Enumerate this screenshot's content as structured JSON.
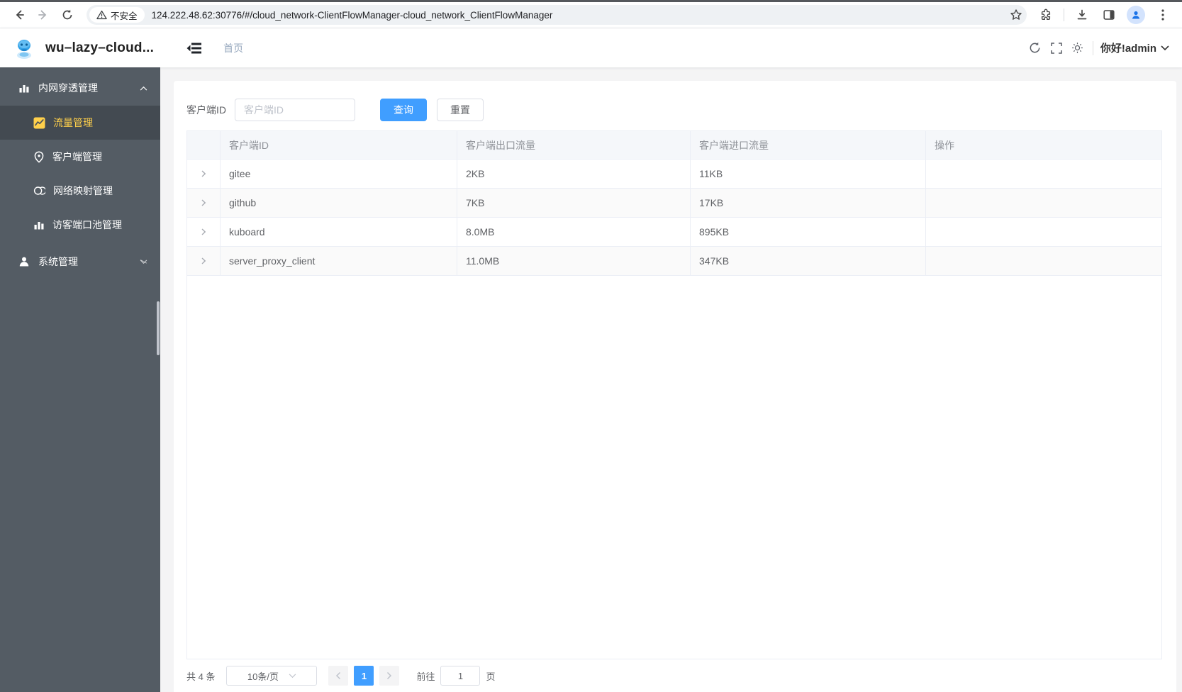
{
  "browser": {
    "security_label": "不安全",
    "url": "124.222.48.62:30776/#/cloud_network-ClientFlowManager-cloud_network_ClientFlowManager"
  },
  "app_header": {
    "title": "wu–lazy–cloud...",
    "breadcrumb": "首页",
    "greeting": "你好!admin"
  },
  "sidebar": {
    "groups": [
      {
        "label": "内网穿透管理",
        "expanded": true,
        "children": [
          {
            "label": "流量管理",
            "active": true
          },
          {
            "label": "客户端管理"
          },
          {
            "label": "网络映射管理"
          },
          {
            "label": "访客端口池管理"
          }
        ]
      },
      {
        "label": "系统管理",
        "expanded": false,
        "children": []
      }
    ]
  },
  "filter": {
    "label": "客户端ID",
    "placeholder": "客户端ID",
    "search_label": "查询",
    "reset_label": "重置"
  },
  "table": {
    "columns": [
      "",
      "客户端ID",
      "客户端出口流量",
      "客户端进口流量",
      "操作"
    ],
    "rows": [
      {
        "client_id": "gitee",
        "outbound": "2KB",
        "inbound": "11KB"
      },
      {
        "client_id": "github",
        "outbound": "7KB",
        "inbound": "17KB"
      },
      {
        "client_id": "kuboard",
        "outbound": "8.0MB",
        "inbound": "895KB"
      },
      {
        "client_id": "server_proxy_client",
        "outbound": "11.0MB",
        "inbound": "347KB"
      }
    ]
  },
  "pagination": {
    "total_label": "共 4 条",
    "page_size_label": "10条/页",
    "active_page": "1",
    "goto_label": "前往",
    "goto_value": "1",
    "page_unit_label": "页"
  },
  "colors": {
    "primary_blue": "#409eff",
    "sidebar_bg": "#545c64",
    "sidebar_active_bg": "#434a51",
    "sidebar_active_text": "#ffd04b",
    "table_header_bg": "#f5f7fa",
    "table_border": "#ebeef5"
  },
  "icons": {
    "back": "back-arrow",
    "forward": "forward-arrow",
    "reload": "reload-circular-arrow",
    "warning": "warning-triangle",
    "star": "bookmark-star",
    "extensions": "puzzle-piece",
    "download": "download-arrow-tray",
    "side_panel": "split-panel",
    "profile": "person-avatar",
    "menu": "three-dot-menu",
    "collapse": "collapse-sidebar",
    "refresh": "refresh",
    "fullscreen": "fullscreen-brackets",
    "theme": "sun",
    "caret": "chevron-down",
    "group1": "bar-chart",
    "flow": "trend-line-square",
    "client": "location-pin",
    "mapping": "linked-circles",
    "pool": "bar-chart",
    "system": "person",
    "expand_row": "chevron-right"
  }
}
